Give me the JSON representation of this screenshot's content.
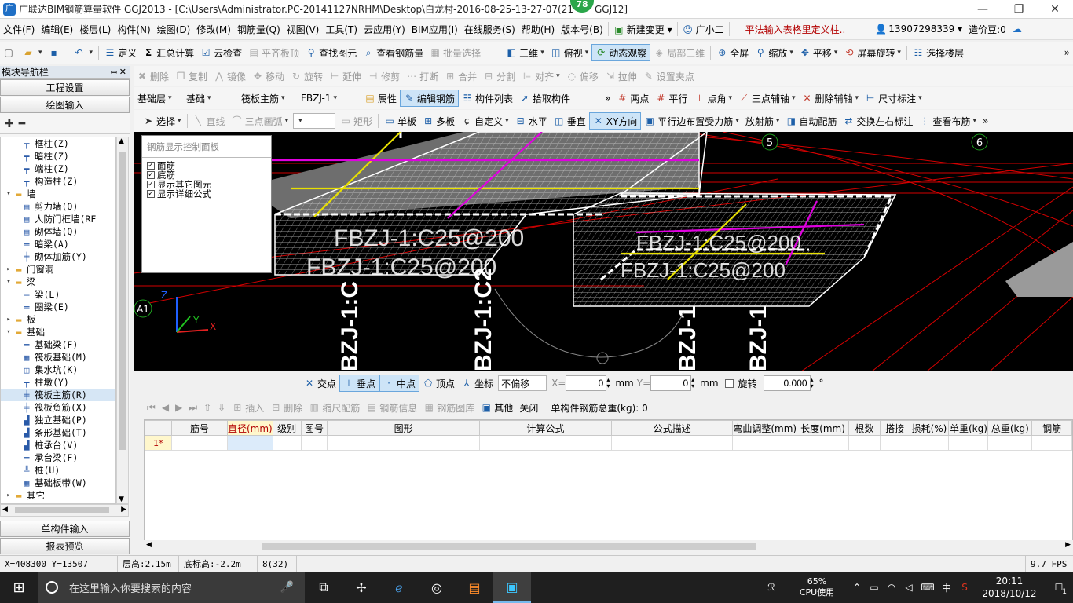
{
  "window": {
    "title": "广联达BIM钢筋算量软件 GGJ2013 - [C:\\Users\\Administrator.PC-20141127NRHM\\Desktop\\白龙村-2016-08-25-13-27-07(21",
    "title_tail": "GGJ12]",
    "badge": "78",
    "min": "—",
    "restore": "❐",
    "close": "✕"
  },
  "menubar": {
    "items": [
      "文件(F)",
      "编辑(E)",
      "楼层(L)",
      "构件(N)",
      "绘图(D)",
      "修改(M)",
      "钢筋量(Q)",
      "视图(V)",
      "工具(T)",
      "云应用(Y)",
      "BIM应用(I)",
      "在线服务(S)",
      "帮助(H)",
      "版本号(B)"
    ],
    "new_change": "新建变更",
    "guangxiaoer": "广小二",
    "notice": "平法输入表格里定义柱..",
    "phone": "13907298339",
    "cost_beans": "造价豆:0"
  },
  "toolbar1": {
    "define": "定义",
    "sum": "汇总计算",
    "cloud_check": "云检查",
    "align_top": "平齐板顶",
    "find": "查找图元",
    "view_rebar": "查看钢筋量",
    "batch_select": "批量选择",
    "three_d": "三维",
    "top_view": "俯视",
    "dynamic": "动态观察",
    "local_3d": "局部三维",
    "fullscreen": "全屏",
    "zoom": "缩放",
    "pan": "平移",
    "rotate_screen": "屏幕旋转",
    "select_floor": "选择楼层"
  },
  "toolbar2": {
    "delete": "删除",
    "copy": "复制",
    "mirror": "镜像",
    "move": "移动",
    "rotate": "旋转",
    "extend": "延伸",
    "trim": "修剪",
    "break": "打断",
    "merge": "合并",
    "split": "分割",
    "align": "对齐",
    "offset": "偏移",
    "stretch": "拉伸",
    "set_grip": "设置夹点"
  },
  "toolbar3": {
    "floor": "基础层",
    "category": "基础",
    "type": "筏板主筋",
    "name": "FBZJ-1",
    "props": "属性",
    "edit_rebar": "编辑钢筋",
    "comp_list": "构件列表",
    "pick": "拾取构件",
    "two_point": "两点",
    "parallel": "平行",
    "point_angle": "点角",
    "three_point_axis": "三点辅轴",
    "del_axis": "删除辅轴",
    "dim": "尺寸标注"
  },
  "toolbar4": {
    "select": "选择",
    "line": "直线",
    "arc": "三点画弧",
    "rect": "矩形",
    "single": "单板",
    "multi": "多板",
    "custom": "自定义",
    "horizontal": "水平",
    "vertical": "垂直",
    "xy": "XY方向",
    "parallel_edge": "平行边布置受力筋",
    "radial": "放射筋",
    "auto": "自动配筋",
    "swap": "交换左右标注",
    "view_layout": "查看布筋"
  },
  "nav": {
    "title": "模块导航栏",
    "pin": "ꟷ",
    "close": "✕",
    "project_settings": "工程设置",
    "drawing_input": "绘图输入",
    "tree": [
      {
        "level": 2,
        "label": "框柱(Z)",
        "icon": "column-icon"
      },
      {
        "level": 2,
        "label": "暗柱(Z)",
        "icon": "column-icon"
      },
      {
        "level": 2,
        "label": "端柱(Z)",
        "icon": "column-icon"
      },
      {
        "level": 2,
        "label": "构造柱(Z)",
        "icon": "column-icon"
      },
      {
        "level": 1,
        "label": "墙",
        "expanded": true,
        "folder": true
      },
      {
        "level": 2,
        "label": "剪力墙(Q)",
        "icon": "wall-icon"
      },
      {
        "level": 2,
        "label": "人防门框墙(RF",
        "icon": "wall-icon"
      },
      {
        "level": 2,
        "label": "砌体墙(Q)",
        "icon": "wall-icon"
      },
      {
        "level": 2,
        "label": "暗梁(A)",
        "icon": "beam-icon"
      },
      {
        "level": 2,
        "label": "砌体加筋(Y)",
        "icon": "rebar-icon"
      },
      {
        "level": 1,
        "label": "门窗洞",
        "expanded": false,
        "folder": true
      },
      {
        "level": 1,
        "label": "梁",
        "expanded": true,
        "folder": true
      },
      {
        "level": 2,
        "label": "梁(L)",
        "icon": "beam-icon"
      },
      {
        "level": 2,
        "label": "圈梁(E)",
        "icon": "beam-icon"
      },
      {
        "level": 1,
        "label": "板",
        "expanded": false,
        "folder": true
      },
      {
        "level": 1,
        "label": "基础",
        "expanded": true,
        "folder": true
      },
      {
        "level": 2,
        "label": "基础梁(F)",
        "icon": "beam-icon"
      },
      {
        "level": 2,
        "label": "筏板基础(M)",
        "icon": "slab-icon"
      },
      {
        "level": 2,
        "label": "集水坑(K)",
        "icon": "pit-icon"
      },
      {
        "level": 2,
        "label": "柱墩(Y)",
        "icon": "column-icon"
      },
      {
        "level": 2,
        "label": "筏板主筋(R)",
        "icon": "rebar-icon",
        "selected": true
      },
      {
        "level": 2,
        "label": "筏板负筋(X)",
        "icon": "rebar-icon"
      },
      {
        "level": 2,
        "label": "独立基础(P)",
        "icon": "footing-icon"
      },
      {
        "level": 2,
        "label": "条形基础(T)",
        "icon": "footing-icon"
      },
      {
        "level": 2,
        "label": "桩承台(V)",
        "icon": "footing-icon"
      },
      {
        "level": 2,
        "label": "承台梁(F)",
        "icon": "beam-icon"
      },
      {
        "level": 2,
        "label": "桩(U)",
        "icon": "pile-icon"
      },
      {
        "level": 2,
        "label": "基础板带(W)",
        "icon": "slab-icon"
      },
      {
        "level": 1,
        "label": "其它",
        "expanded": false,
        "folder": true
      }
    ],
    "single_input": "单构件输入",
    "report": "报表预览"
  },
  "ctrlpanel": {
    "title": "钢筋显示控制面板",
    "items": [
      "面筋",
      "底筋",
      "显示其它图元",
      "显示详细公式"
    ]
  },
  "viewport": {
    "axis_labels": [
      "5",
      "6",
      "A1"
    ],
    "annotations": [
      "FBZJ-1:C25@200",
      "FBZJ-1:C25@200",
      "FBZJ-1:C25@200",
      "FBZJ-1:C25@200"
    ],
    "vert_labels": [
      "BZJ-1:C",
      "BZJ-1:C2",
      "BZJ-1",
      "BZJ-1"
    ],
    "colors": {
      "bg": "#000000",
      "mesh": "#ffffff",
      "red": "#e00000",
      "yellow": "#e8e000",
      "magenta": "#e000e0"
    }
  },
  "snapbar": {
    "intersect": "交点",
    "perp": "垂点",
    "mid": "中点",
    "vertex": "顶点",
    "coord": "坐标",
    "offset_mode": "不偏移",
    "x_label": "X=",
    "x_val": "0",
    "mm1": "mm",
    "y_label": "Y=",
    "y_val": "0",
    "mm2": "mm",
    "rotate": "旋转",
    "rot_val": "0.000",
    "deg": "°"
  },
  "rebarbar": {
    "insert": "插入",
    "delete": "删除",
    "scale": "缩尺配筋",
    "info": "钢筋信息",
    "library": "钢筋图库",
    "other": "其他",
    "close": "关闭",
    "total": "单构件钢筋总重(kg): 0"
  },
  "grid": {
    "columns": [
      "筋号",
      "直径(mm)",
      "级别",
      "图号",
      "图形",
      "计算公式",
      "公式描述",
      "弯曲调整(mm)",
      "长度(mm)",
      "根数",
      "搭接",
      "损耗(%)",
      "单重(kg)",
      "总重(kg)",
      "钢筋"
    ],
    "rows": [
      {
        "rn": "1*"
      }
    ]
  },
  "status": {
    "coord": "X=408300 Y=13507",
    "floor_height": "层高:2.15m",
    "base_height": "底标高:-2.2m",
    "count": "8(32)",
    "fps": "9.7 FPS"
  },
  "taskbar": {
    "search_placeholder": "在这里输入你要搜索的内容",
    "cpu_pct": "65%",
    "cpu_label": "CPU使用",
    "ime": "中",
    "time": "20:11",
    "date": "2018/10/12",
    "notif": "1"
  }
}
